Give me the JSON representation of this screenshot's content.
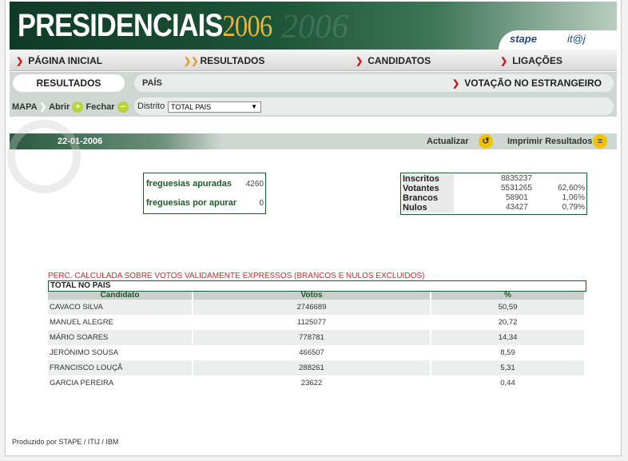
{
  "header": {
    "logo_main": "PRESIDENCIAIS",
    "logo_year": "2006",
    "ghost_text": "2006",
    "partner1": "stape",
    "partner2": "it@j"
  },
  "nav": {
    "items": [
      {
        "label": "PÁGINA INICIAL",
        "arrow": "❯"
      },
      {
        "label": "RESULTADOS",
        "arrow": "❯❯"
      },
      {
        "label": "CANDIDATOS",
        "arrow": "❯"
      },
      {
        "label": "LIGAÇÕES",
        "arrow": "❯"
      }
    ]
  },
  "subnav": {
    "results_button": "RESULTADOS",
    "pais_label": "PAÍS",
    "abroad_label": "VOTAÇÃO NO ESTRANGEIRO",
    "abroad_arrow": "❯",
    "mapa_label": "MAPA",
    "abrir_label": "Abrir",
    "fechar_label": "Fechar",
    "distrito_label": "Distrito",
    "distrito_value": "TOTAL PAIS"
  },
  "datebar": {
    "date": "22-01-2006",
    "actualizar": "Actualizar",
    "imprimir": "Imprimir Resultados"
  },
  "freguesias": {
    "apuradas_label": "freguesias apuradas",
    "apuradas_value": "4260",
    "por_apurar_label": "freguesias por apurar",
    "por_apurar_value": "0"
  },
  "summary": {
    "rows": [
      {
        "label": "Inscritos",
        "value": "8835237",
        "pct": ""
      },
      {
        "label": "Votantes",
        "value": "5531265",
        "pct": "62,60%"
      },
      {
        "label": "Brancos",
        "value": "58901",
        "pct": "1,06%"
      },
      {
        "label": "Nulos",
        "value": "43427",
        "pct": "0,79%"
      }
    ]
  },
  "results": {
    "note": "PERC. CALCULADA SOBRE VOTOS VALIDAMENTE EXPRESSOS (BRANCOS E NULOS EXCLUIDOS)",
    "total_label": "TOTAL NO PAIS",
    "headers": [
      "Candidato",
      "Votos",
      "%"
    ],
    "rows": [
      {
        "candidate": "CAVACO SILVA",
        "votes": "2746689",
        "pct": "50,59"
      },
      {
        "candidate": "MANUEL ALEGRE",
        "votes": "1125077",
        "pct": "20,72"
      },
      {
        "candidate": "MÁRIO SOARES",
        "votes": "778781",
        "pct": "14,34"
      },
      {
        "candidate": "JERÓNIMO SOUSA",
        "votes": "466507",
        "pct": "8,59"
      },
      {
        "candidate": "FRANCISCO LOUÇÃ",
        "votes": "288261",
        "pct": "5,31"
      },
      {
        "candidate": "GARCIA PEREIRA",
        "votes": "23622",
        "pct": "0,44"
      }
    ]
  },
  "footer": {
    "text": "Produzido por STAPE / ITIJ / IBM"
  },
  "colors": {
    "brand_green": "#1d5a2a",
    "accent_red": "#c32020",
    "year_gold": "#e6b53a"
  }
}
